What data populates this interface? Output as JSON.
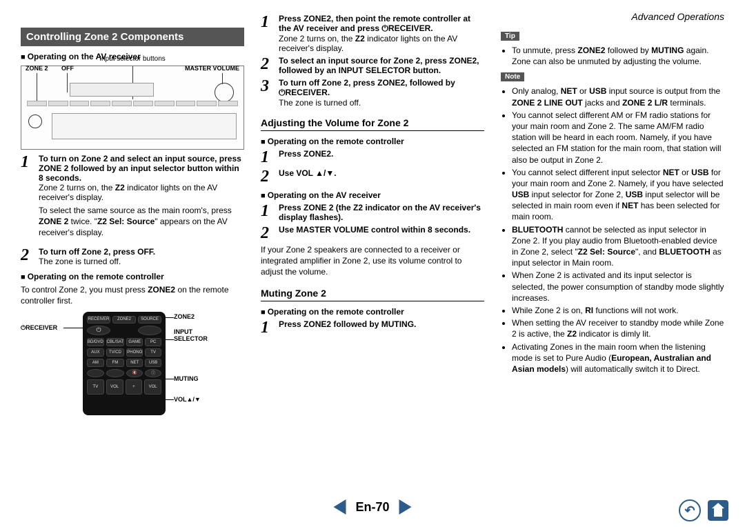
{
  "header": {
    "right": "Advanced Operations"
  },
  "section_banner": "Controlling Zone 2 Components",
  "col1": {
    "h_receiver": "Operating on the AV receiver",
    "diagram": {
      "top": "Input selector buttons",
      "zone2": "ZONE 2",
      "off": "OFF",
      "mvol": "MASTER VOLUME"
    },
    "step1": "To turn on Zone 2 and select an input source, press ZONE 2 followed by an input selector button within 8 seconds.",
    "step1_body1_a": "Zone 2 turns on, the ",
    "step1_body1_b": "Z2",
    "step1_body1_c": " indicator lights on the AV receiver's display.",
    "step1_body2_a": "To select the same source as the main room's, press ",
    "step1_body2_b": "ZONE 2",
    "step1_body2_c": " twice. \"",
    "step1_body2_d": "Z2 Sel: Source",
    "step1_body2_e": "\" appears on the AV receiver's display.",
    "step2": "To turn off Zone 2, press OFF.",
    "step2_body": "The zone is turned off.",
    "h_remote": "Operating on the remote controller",
    "remote_intro_a": "To control Zone 2, you must press ",
    "remote_intro_b": "ZONE2",
    "remote_intro_c": " on the remote controller first.",
    "labels": {
      "receiver": "⏻RECEIVER",
      "zone2": "ZONE2",
      "input_selector": "INPUT SELECTOR",
      "muting": "MUTING",
      "vol": "VOL▲/▼"
    },
    "remote_buttons": {
      "top": [
        "RECEIVER",
        "ZONE2",
        "SOURCE"
      ],
      "power": "⏻",
      "grid": [
        "BD/DVD",
        "CBL/SAT",
        "GAME",
        "PC",
        "AUX",
        "TV/CD",
        "PHONO",
        "TV",
        "AM",
        "FM",
        "NET",
        "USB",
        "",
        "",
        "",
        "ⓘ"
      ],
      "bot": [
        "TV",
        "VOL",
        "+",
        "VOL"
      ],
      "muting": "🔇"
    }
  },
  "col2": {
    "step1_a": "Press ZONE2, then point the remote controller at the AV receiver and press ",
    "step1_b": "⏻RECEIVER.",
    "step1_body_a": "Zone 2 turns on, the ",
    "step1_body_b": "Z2",
    "step1_body_c": " indicator lights on the AV receiver's display.",
    "step2": "To select an input source for Zone 2, press ZONE2, followed by an INPUT SELECTOR button.",
    "step3_a": "To turn off Zone 2, press ZONE2, followed by ",
    "step3_b": "⏻RECEIVER.",
    "step3_body": "The zone is turned off.",
    "sub_vol": "Adjusting the Volume for Zone 2",
    "h_remote": "Operating on the remote controller",
    "vstep1": "Press ZONE2.",
    "vstep2": "Use VOL ▲/▼.",
    "h_receiver": "Operating on the AV receiver",
    "rstep1": "Press ZONE 2 (the Z2 indicator on the AV receiver's display flashes).",
    "rstep2": "Use MASTER VOLUME control within 8 seconds.",
    "vol_note": "If your Zone 2 speakers are connected to a receiver or integrated amplifier in Zone 2, use its volume control to adjust the volume.",
    "sub_mute": "Muting Zone 2",
    "mstep1": "Press ZONE2 followed by MUTING."
  },
  "col3": {
    "tip_label": "Tip",
    "tip1_a": "To unmute, press ",
    "tip1_b": "ZONE2",
    "tip1_c": " followed by ",
    "tip1_d": "MUTING",
    "tip1_e": " again. Zone can also be unmuted by adjusting the volume.",
    "note_label": "Note",
    "n1_a": "Only analog, ",
    "n1_b": "NET",
    "n1_c": " or ",
    "n1_d": "USB",
    "n1_e": " input source is output from the ",
    "n1_f": "ZONE 2 LINE OUT",
    "n1_g": " jacks and ",
    "n1_h": "ZONE 2 L/R",
    "n1_i": " terminals.",
    "n2": "You cannot select different AM or FM radio stations for your main room and Zone 2. The same AM/FM radio station will be heard in each room. Namely, if you have selected an FM station for the main room, that station will also be output in Zone 2.",
    "n3_a": "You cannot select different input selector ",
    "n3_b": "NET",
    "n3_c": " or ",
    "n3_d": "USB",
    "n3_e": " for your main room and Zone 2. Namely, if you have selected ",
    "n3_f": "USB",
    "n3_g": " input selector for Zone 2, ",
    "n3_h": "USB",
    "n3_i": " input selector will be selected in main room even if ",
    "n3_j": "NET",
    "n3_k": " has been selected for main room.",
    "n4_a": "BLUETOOTH",
    "n4_b": " cannot be selected as input selector in Zone 2. If you play audio from Bluetooth-enabled device in Zone 2, select \"",
    "n4_c": "Z2 Sel: Source",
    "n4_d": "\", and ",
    "n4_e": "BLUETOOTH",
    "n4_f": " as input selector in Main room.",
    "n5": "When Zone 2 is activated and its input selector is selected, the power consumption of standby mode slightly increases.",
    "n6_a": "While Zone 2 is on, ",
    "n6_b": "RI",
    "n6_c": " functions will not work.",
    "n7_a": "When setting the AV receiver to standby mode while Zone 2 is active, the ",
    "n7_b": "Z2",
    "n7_c": " indicator is dimly lit.",
    "n8_a": "Activating Zones in the main room when the listening mode is set to Pure Audio (",
    "n8_b": "European, Australian and Asian models",
    "n8_c": ") will automatically switch it to Direct."
  },
  "footer": {
    "page": "En-70"
  }
}
